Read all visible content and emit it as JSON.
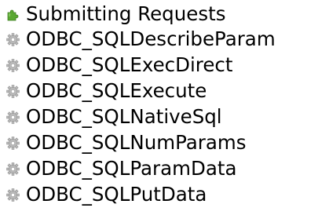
{
  "tree": {
    "folder": {
      "label": "Submitting Requests",
      "icon": "puzzle-piece-icon",
      "icon_color": "#5aa832"
    },
    "items": [
      {
        "label": "ODBC_SQLDescribeParam",
        "icon": "gear-icon"
      },
      {
        "label": "ODBC_SQLExecDirect",
        "icon": "gear-icon"
      },
      {
        "label": "ODBC_SQLExecute",
        "icon": "gear-icon"
      },
      {
        "label": "ODBC_SQLNativeSql",
        "icon": "gear-icon"
      },
      {
        "label": "ODBC_SQLNumParams",
        "icon": "gear-icon"
      },
      {
        "label": "ODBC_SQLParamData",
        "icon": "gear-icon"
      },
      {
        "label": "ODBC_SQLPutData",
        "icon": "gear-icon"
      }
    ],
    "gear_icon_color": "#b9b9b9"
  }
}
